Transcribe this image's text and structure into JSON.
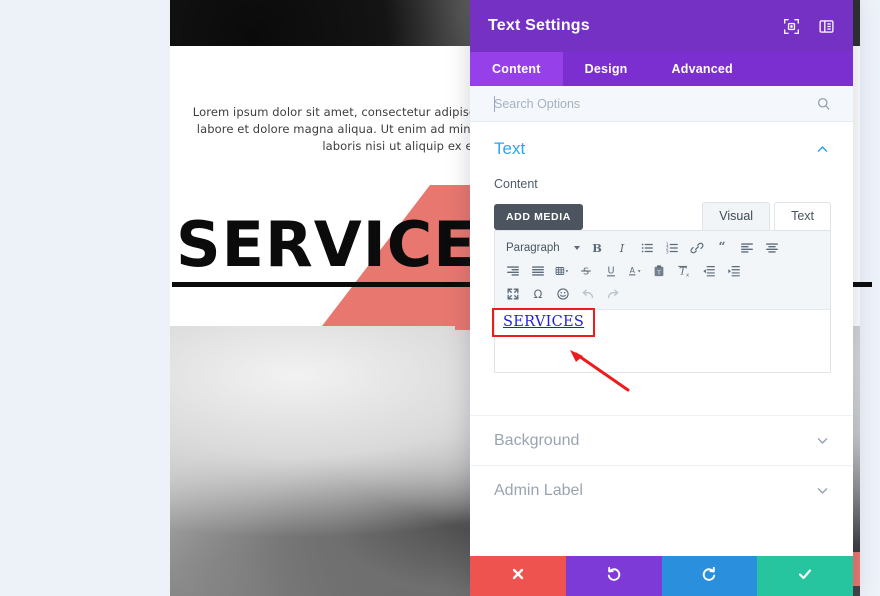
{
  "background_page": {
    "paragraph": "Lorem ipsum dolor sit amet, consectetur adipiscing elit, sed do eiusmod tempor incididunt ut labore et dolore magna aliqua. Ut enim ad minim veniam, quis nostrud exercitation ullamco laboris nisi ut aliquip ex ea commodo consequat.",
    "heading": "SERVICES",
    "accent_color": "#e8776f",
    "hero_image_name": "office-hero-photo",
    "lower_image_name": "office-workspace-photo"
  },
  "panel": {
    "title": "Text Settings",
    "brand_color": "#7530c4",
    "header_icons": [
      {
        "name": "focus-mode-icon"
      },
      {
        "name": "panel-layout-icon"
      }
    ],
    "tabs": [
      {
        "label": "Content",
        "active": true
      },
      {
        "label": "Design",
        "active": false
      },
      {
        "label": "Advanced",
        "active": false
      }
    ],
    "search": {
      "value": "",
      "placeholder": "Search Options",
      "icon": "search-icon"
    },
    "sections": {
      "text": {
        "title": "Text",
        "expanded": true,
        "toggle_icon": "chevron-up-icon",
        "accent_color": "#2ea3f2",
        "content_label": "Content",
        "add_media_label": "ADD MEDIA",
        "editor_tabs": [
          {
            "label": "Visual",
            "active": true
          },
          {
            "label": "Text",
            "active": false
          }
        ],
        "toolbar": {
          "format_select": "Paragraph",
          "row1": [
            "bold-icon",
            "italic-icon",
            "bulleted-list-icon",
            "numbered-list-icon",
            "link-icon",
            "blockquote-icon",
            "align-left-icon",
            "align-center-icon"
          ],
          "row2": [
            "align-right-icon",
            "justify-icon",
            "table-icon",
            "strikethrough-icon",
            "underline-icon",
            "text-color-icon",
            "paste-as-text-icon",
            "clear-formatting-icon",
            "outdent-icon",
            "indent-icon"
          ],
          "row3": [
            "fullscreen-icon",
            "special-character-icon",
            "emoji-icon",
            "undo-icon",
            "redo-icon"
          ]
        },
        "editor_content": "SERVICES"
      },
      "background": {
        "title": "Background",
        "expanded": false,
        "toggle_icon": "chevron-down-icon"
      },
      "admin_label": {
        "title": "Admin Label",
        "expanded": false,
        "toggle_icon": "chevron-down-icon"
      }
    },
    "footer_buttons": [
      {
        "name": "cancel-button",
        "icon": "close-icon",
        "color": "#ef5350"
      },
      {
        "name": "undo-button",
        "icon": "undo-icon",
        "color": "#7e3ad6"
      },
      {
        "name": "redo-button",
        "icon": "redo-icon",
        "color": "#2a8fdd"
      },
      {
        "name": "save-button",
        "icon": "check-icon",
        "color": "#27c4a0"
      }
    ]
  },
  "annotation": {
    "color": "#ec1c1c",
    "highlight_target": "SERVICES",
    "arrow_name": "annotation-arrow"
  }
}
